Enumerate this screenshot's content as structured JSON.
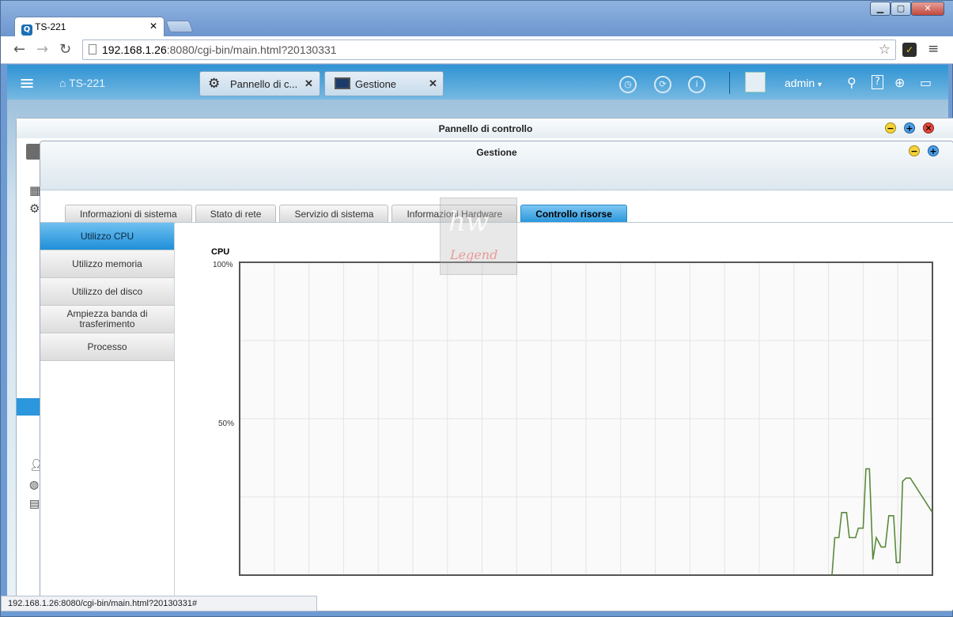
{
  "browser": {
    "tab_title": "TS-221",
    "url_host": "192.168.1.26",
    "url_rest": ":8080/cgi-bin/main.html?20130331",
    "status_url": "192.168.1.26:8080/cgi-bin/main.html?20130331#"
  },
  "qts": {
    "home_label": "TS-221",
    "app_tabs": [
      "Pannello di c...",
      "Gestione"
    ],
    "user": "admin"
  },
  "control_panel": {
    "title": "Pannello di controllo"
  },
  "gestione": {
    "title": "Gestione",
    "tabs": [
      "Informazioni di sistema",
      "Stato di rete",
      "Servizio di sistema",
      "Informazioni Hardware",
      "Controllo risorse"
    ],
    "active_tab": "Controllo risorse",
    "side_items": [
      "Utilizzo CPU",
      "Utilizzo memoria",
      "Utilizzo del disco",
      "Ampiezza banda di trasferimento",
      "Processo"
    ],
    "active_side": "Utilizzo CPU"
  },
  "chart_data": {
    "type": "line",
    "title": "CPU",
    "yticks": [
      "100%",
      "50%"
    ],
    "ylim": [
      0,
      100
    ],
    "grid": true,
    "series": [
      {
        "color": "#5a8a3c",
        "points": [
          [
            0.855,
            0
          ],
          [
            0.859,
            12
          ],
          [
            0.865,
            12
          ],
          [
            0.869,
            20
          ],
          [
            0.876,
            20
          ],
          [
            0.88,
            12
          ],
          [
            0.889,
            12
          ],
          [
            0.893,
            15
          ],
          [
            0.9,
            15
          ],
          [
            0.904,
            34
          ],
          [
            0.909,
            34
          ],
          [
            0.914,
            5
          ],
          [
            0.919,
            12
          ],
          [
            0.926,
            9
          ],
          [
            0.932,
            9
          ],
          [
            0.937,
            19
          ],
          [
            0.944,
            19
          ],
          [
            0.948,
            4
          ],
          [
            0.953,
            4
          ],
          [
            0.957,
            30
          ],
          [
            0.962,
            31
          ],
          [
            0.968,
            31
          ],
          [
            1.0,
            20
          ]
        ]
      }
    ]
  },
  "watermark": "HW Legend"
}
